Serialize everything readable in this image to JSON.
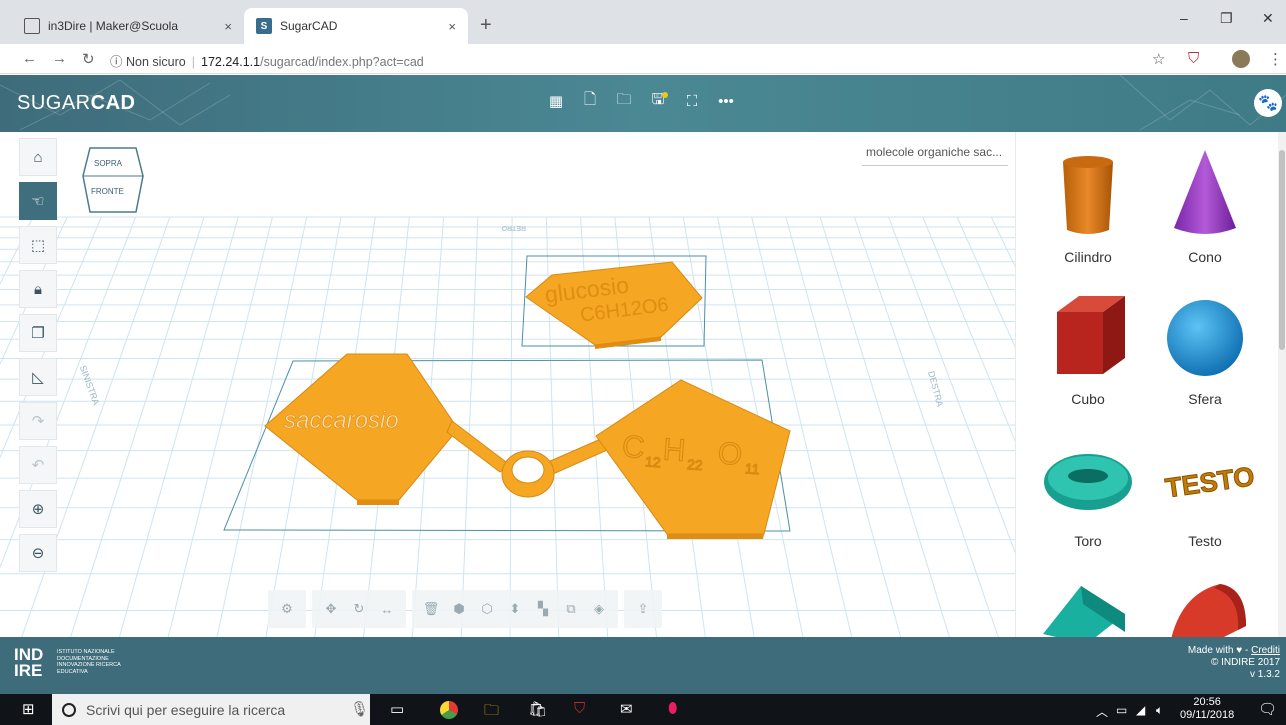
{
  "browser": {
    "tabs": [
      {
        "label": "in3Dire | Maker@Scuola",
        "close": "×"
      },
      {
        "label": "SugarCAD",
        "close": "×",
        "favicon": "S"
      }
    ],
    "new_tab": "+",
    "window_controls": [
      "–",
      "❐",
      "✕"
    ],
    "url_security": "Non sicuro",
    "url_host": "172.24.1.1",
    "url_path": "/sugarcad/index.php?act=cad"
  },
  "app": {
    "logo_light": "SUGAR",
    "logo_bold": "CAD",
    "header_icons": [
      "grid-icon",
      "new-file-icon",
      "open-folder-icon",
      "save-icon",
      "fullscreen-icon",
      "more-icon"
    ],
    "project_name": "molecole organiche sac...",
    "left_tools": [
      "home-icon",
      "pan-icon",
      "box-select-icon",
      "lock-icon",
      "copy-icon",
      "ruler-icon",
      "redo-icon",
      "undo-icon",
      "zoom-in-icon",
      "zoom-out-icon"
    ],
    "viewcube": {
      "top": "SOPRA",
      "front": "FRONTE"
    },
    "grid_labels": {
      "back": "RETRO",
      "left": "SINISTRA",
      "right": "DESTRA"
    },
    "scene_text": {
      "glucose_name": "glucosio",
      "glucose_formula": "C6H12O6",
      "sucrose_name": "saccarosio",
      "sucrose_formula_c": "C",
      "sucrose_formula_12": "12",
      "sucrose_formula_h": "H",
      "sucrose_formula_22": "22",
      "sucrose_formula_o": "O",
      "sucrose_formula_11": "11"
    },
    "shapes": [
      {
        "label": "Cilindro",
        "color": "#d97a10"
      },
      {
        "label": "Cono",
        "color": "#9b3fc4"
      },
      {
        "label": "Cubo",
        "color": "#c0282a"
      },
      {
        "label": "Sfera",
        "color": "#1a8fd6"
      },
      {
        "label": "Toro",
        "color": "#1aa89a"
      },
      {
        "label": "Testo",
        "color": "#e8a017",
        "sample_text": "TESTO"
      }
    ],
    "accent_color": "#3e6c7b",
    "object_color": "#f5a623"
  },
  "footer": {
    "logo_big_1": "IND",
    "logo_big_2": "IRE",
    "logo_small": "ISTITUTO NAZIONALE DOCUMENTAZIONE INNOVAZIONE RICERCA EDUCATIVA",
    "made_with": "Made with ♥ - ",
    "credits_link": "Crediti",
    "copyright": "© INDIRE 2017",
    "version": "v 1.3.2"
  },
  "taskbar": {
    "search_placeholder": "Scrivi qui per eseguire la ricerca",
    "time": "20:56",
    "date": "09/11/2018"
  }
}
